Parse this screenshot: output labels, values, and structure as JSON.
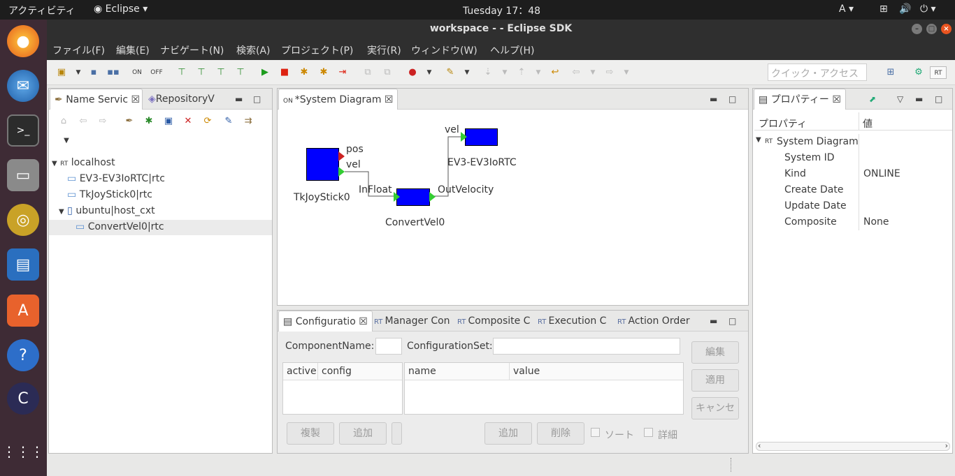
{
  "topbar": {
    "activities": "アクティビティ",
    "app": "Eclipse",
    "clock": "Tuesday 17：48",
    "lang": "A"
  },
  "window": {
    "title": "workspace -  - Eclipse SDK"
  },
  "menu": [
    "ファイル(F)",
    "編集(E)",
    "ナビゲート(N)",
    "検索(A)",
    "プロジェクト(P)",
    "実行(R)",
    "ウィンドウ(W)",
    "ヘルプ(H)"
  ],
  "toolbar": {
    "quick_access_placeholder": "クイック・アクセス"
  },
  "left_panel": {
    "tabs": [
      "Name Servic",
      "RepositoryV"
    ],
    "tree": {
      "root": "localhost",
      "items": [
        "EV3-EV3IoRTC|rtc",
        "TkJoyStick0|rtc",
        "ubuntu|host_cxt",
        "ConvertVel0|rtc"
      ]
    }
  },
  "editor": {
    "tab": "*System Diagram",
    "components": [
      {
        "name": "TkJoyStick0",
        "ports": [
          "pos",
          "vel"
        ]
      },
      {
        "name": "ConvertVel0",
        "ports": [
          "InFloat",
          "OutVelocity"
        ]
      },
      {
        "name": "EV3-EV3IoRTC",
        "ports": [
          "vel"
        ]
      }
    ]
  },
  "config_panel": {
    "tabs": [
      "Configuratio",
      "Manager Con",
      "Composite C",
      "Execution C",
      "Action Order"
    ],
    "component_name_label": "ComponentName:",
    "config_set_label": "ConfigurationSet:",
    "table1_headers": [
      "active",
      "config"
    ],
    "table2_headers": [
      "name",
      "value"
    ],
    "buttons": {
      "edit": "編集",
      "apply": "適用",
      "cancel": "キャンセ",
      "copy": "複製",
      "add1": "追加",
      "add2": "追加",
      "delete": "削除"
    },
    "checks": {
      "sort": "ソート",
      "detail": "詳細"
    }
  },
  "properties": {
    "tab": "プロパティー",
    "headers": [
      "プロパティ",
      "値"
    ],
    "root": "System Diagram",
    "rows": [
      {
        "key": "System ID",
        "value": ""
      },
      {
        "key": "Kind",
        "value": "ONLINE"
      },
      {
        "key": "Create Date",
        "value": ""
      },
      {
        "key": "Update Date",
        "value": ""
      },
      {
        "key": "Composite",
        "value": "None"
      }
    ]
  },
  "colors": {
    "component": "#0000ff",
    "port": "#33cc33",
    "port_out": "#cc2222"
  }
}
